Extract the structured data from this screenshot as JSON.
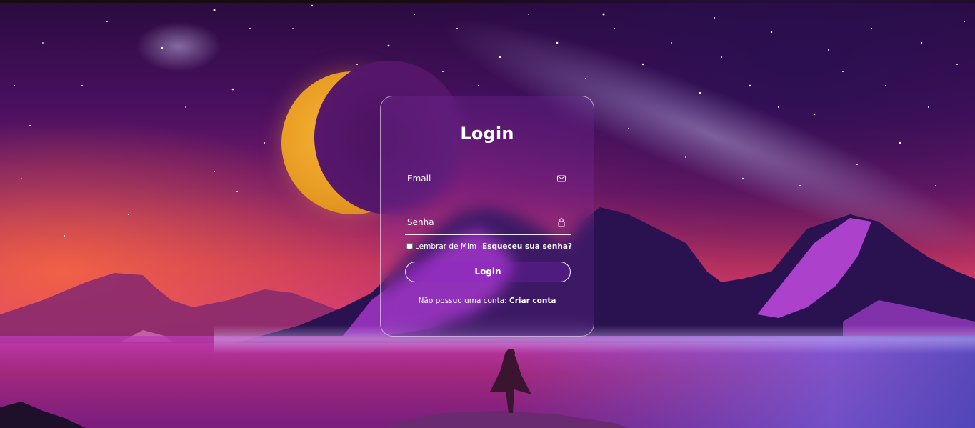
{
  "login": {
    "title": "Login",
    "email_placeholder": "Email",
    "password_placeholder": "Senha",
    "remember_label": "Lembrar de Mim",
    "forgot_link": "Esqueceu sua senha?",
    "submit_label": "Login",
    "register_prompt": "Não possuo uma conta:",
    "register_link": "Criar conta"
  },
  "icons": {
    "email": "mail-icon",
    "password": "lock-icon"
  },
  "colors": {
    "card_border": "#ffffff",
    "text": "#ffffff",
    "moon": "#f0a82a",
    "sky_dark": "#3a0f55"
  }
}
